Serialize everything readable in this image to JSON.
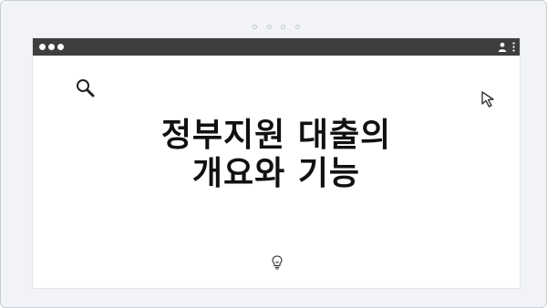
{
  "heading": {
    "line1": "정부지원 대출의",
    "line2": "개요와 기능"
  },
  "icons": {
    "window_controls": "window-dots-icon",
    "user": "user-icon",
    "menu": "kebab-menu-icon",
    "search": "search-icon",
    "cursor": "cursor-arrow-icon",
    "idea": "lightbulb-icon"
  },
  "colors": {
    "titlebar": "#3e3e3e",
    "page_background": "#f1f3f6",
    "window_background": "#ffffff",
    "text": "#111111"
  }
}
